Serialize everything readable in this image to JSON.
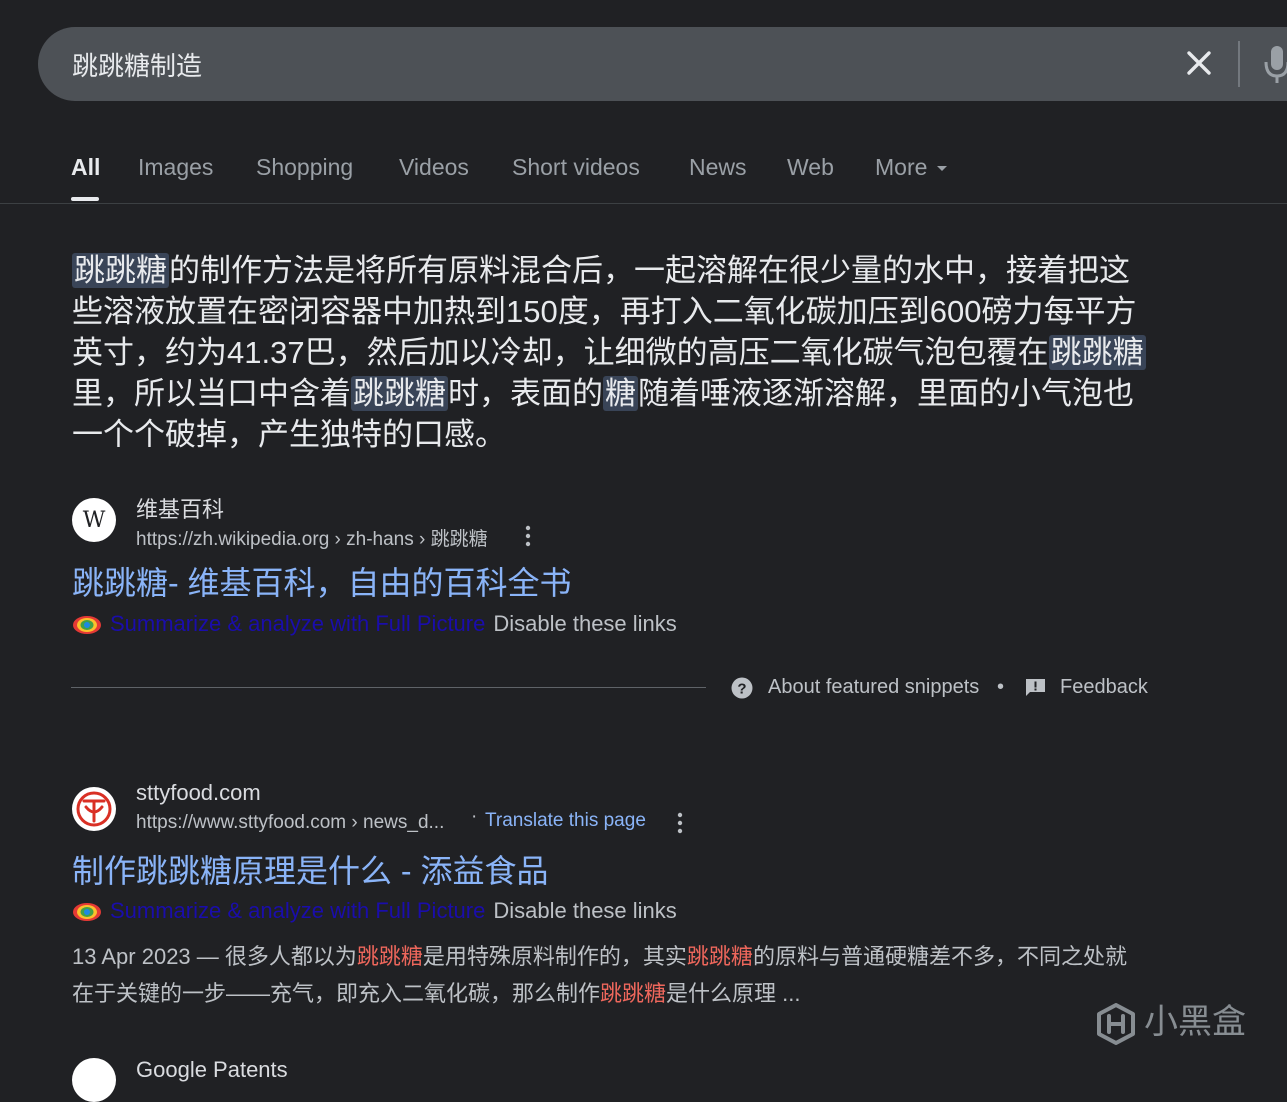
{
  "search": {
    "query": "跳跳糖制造",
    "clear_icon": "close-icon",
    "mic_icon": "microphone-icon"
  },
  "tabs": [
    {
      "label": "All",
      "active": true
    },
    {
      "label": "Images"
    },
    {
      "label": "Shopping"
    },
    {
      "label": "Videos"
    },
    {
      "label": "Short videos"
    },
    {
      "label": "News"
    },
    {
      "label": "Web"
    },
    {
      "label": "More"
    }
  ],
  "snippet": {
    "segments": [
      {
        "t": "跳跳糖",
        "hl": true
      },
      {
        "t": "的制作方法是将所有原料混合后，一起溶解在很少量的水中，接着把这些溶液放置在密闭容器中加热到150度，再打入二氧化碳加压到600磅力每平方英寸，约为41.37巴，然后加以冷却，让细微的高压二氧化碳气泡包覆在"
      },
      {
        "t": "跳跳糖",
        "hl": true
      },
      {
        "t": "里，所以当口中含着"
      },
      {
        "t": "跳跳糖",
        "hl": true
      },
      {
        "t": "时，表面的"
      },
      {
        "t": "糖",
        "hl": true
      },
      {
        "t": "随着唾液逐渐溶解，里面的小气泡也一个个破掉，产生独特的口感。"
      }
    ]
  },
  "result1": {
    "favicon_letter": "W",
    "site_name": "维基百科",
    "url": "https://zh.wikipedia.org › zh-hans › 跳跳糖",
    "title": "跳跳糖- 维基百科，自由的百科全书",
    "summarize": "Summarize & analyze with Full Picture",
    "disable": "Disable these links"
  },
  "featured": {
    "about": "About featured snippets",
    "dot": "•",
    "feedback": "Feedback"
  },
  "result2": {
    "site_name": "sttyfood.com",
    "url": "https://www.sttyfood.com › news_d...",
    "translate_dot": "·",
    "translate": "Translate this page",
    "title": "制作跳跳糖原理是什么 - 添益食品",
    "summarize": "Summarize & analyze with Full Picture",
    "disable": "Disable these links",
    "desc_segments": [
      {
        "t": "13 Apr 2023 — 很多人都以为"
      },
      {
        "t": "跳跳糖",
        "em": true
      },
      {
        "t": "是用特殊原料制作的，其实"
      },
      {
        "t": "跳跳糖",
        "em": true
      },
      {
        "t": "的原料与普通硬糖差不多，不同之处就在于关键的一步——充气，即充入二氧化碳，那么制作"
      },
      {
        "t": "跳跳糖",
        "em": true
      },
      {
        "t": "是什么原理 ..."
      }
    ]
  },
  "result3_partial": {
    "site_name": "Google Patents"
  },
  "watermark": {
    "text": "小黑盒"
  },
  "colors": {
    "background": "#202124",
    "link": "#8ab4f8",
    "highlight": "#394457",
    "emphasis": "#ee675c"
  }
}
